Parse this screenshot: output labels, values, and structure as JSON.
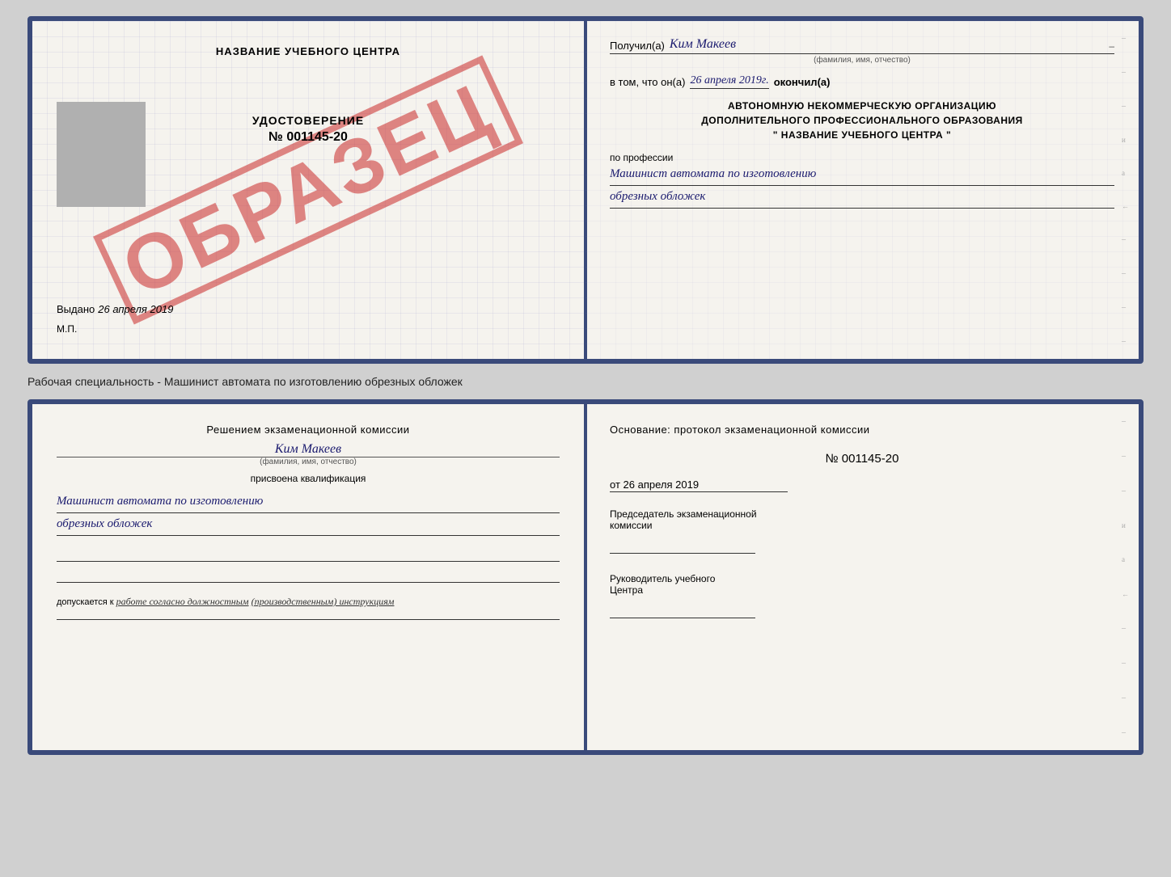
{
  "diploma": {
    "left": {
      "title": "НАЗВАНИЕ УЧЕБНОГО ЦЕНТРА",
      "watermark": "ОБРАЗЕЦ",
      "udostoverenie": "УДОСТОВЕРЕНИЕ",
      "number": "№ 001145-20",
      "vydano_label": "Выдано",
      "vydano_date": "26 апреля 2019",
      "mp": "М.П."
    },
    "right": {
      "poluchil_prefix": "Получил(а)",
      "poluchil_name": "Ким Макеев",
      "poluchil_subtitle": "(фамилия, имя, отчество)",
      "vtom_prefix": "в том, что он(а)",
      "vtom_date": "26 апреля 2019г.",
      "okончил": "окончил(а)",
      "org_line1": "АВТОНОМНУЮ НЕКОММЕРЧЕСКУЮ ОРГАНИЗАЦИЮ",
      "org_line2": "ДОПОЛНИТЕЛЬНОГО ПРОФЕССИОНАЛЬНОГО ОБРАЗОВАНИЯ",
      "org_line3": "\"   НАЗВАНИЕ УЧЕБНОГО ЦЕНТРА   \"",
      "profession_label": "по профессии",
      "profession_line1": "Машинист автомата по изготовлению",
      "profession_line2": "обрезных обложек"
    }
  },
  "specialty_label": "Рабочая специальность - Машинист автомата по изготовлению обрезных обложек",
  "qualification": {
    "left": {
      "decision": "Решением экзаменационной комиссии",
      "name": "Ким Макеев",
      "name_subtitle": "(фамилия, имя, отчество)",
      "assigned": "присвоена квалификация",
      "profession_line1": "Машинист автомата по изготовлению",
      "profession_line2": "обрезных обложек",
      "dopusk_prefix": "допускается к",
      "dopusk_value": "работе согласно должностным",
      "dopusk_cont": "(производственным) инструкциям"
    },
    "right": {
      "osnov_label": "Основание: протокол экзаменационной комиссии",
      "osnov_num": "№  001145-20",
      "osnov_date_prefix": "от",
      "osnov_date": "26 апреля 2019",
      "predsedatel_label": "Председатель экзаменационной",
      "predsedatel_label2": "комиссии",
      "rukov_label": "Руководитель учебного",
      "rukov_label2": "Центра"
    }
  }
}
